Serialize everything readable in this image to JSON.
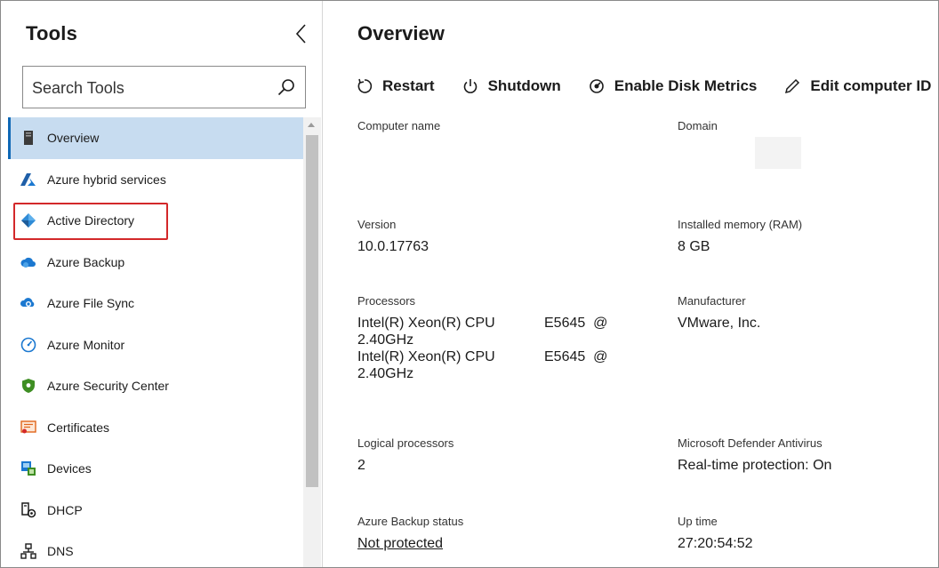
{
  "tools_pane": {
    "title": "Tools",
    "search": {
      "placeholder": "Search Tools",
      "value": ""
    },
    "items": [
      {
        "label": "Overview",
        "icon": "server-icon"
      },
      {
        "label": "Azure hybrid services",
        "icon": "azure-logo-icon"
      },
      {
        "label": "Active Directory",
        "icon": "active-directory-icon"
      },
      {
        "label": "Azure Backup",
        "icon": "cloud-backup-icon"
      },
      {
        "label": "Azure File Sync",
        "icon": "file-sync-icon"
      },
      {
        "label": "Azure Monitor",
        "icon": "gauge-icon"
      },
      {
        "label": "Azure Security Center",
        "icon": "shield-icon"
      },
      {
        "label": "Certificates",
        "icon": "certificate-icon"
      },
      {
        "label": "Devices",
        "icon": "devices-icon"
      },
      {
        "label": "DHCP",
        "icon": "dhcp-icon"
      },
      {
        "label": "DNS",
        "icon": "dns-icon"
      }
    ]
  },
  "overview": {
    "title": "Overview",
    "toolbar": {
      "restart": "Restart",
      "shutdown": "Shutdown",
      "enable_disk_metrics": "Enable Disk Metrics",
      "edit_computer_id": "Edit computer ID"
    },
    "computer_name": {
      "label": "Computer name",
      "value": ""
    },
    "domain": {
      "label": "Domain",
      "value": ""
    },
    "version": {
      "label": "Version",
      "value": "10.0.17763"
    },
    "memory": {
      "label": "Installed memory (RAM)",
      "value": "8 GB"
    },
    "processors": {
      "label": "Processors",
      "entries": [
        {
          "name": "Intel(R) Xeon(R) CPU",
          "model": "E5645  @",
          "speed": "2.40GHz"
        },
        {
          "name": "Intel(R) Xeon(R) CPU",
          "model": "E5645  @",
          "speed": "2.40GHz"
        }
      ]
    },
    "manufacturer": {
      "label": "Manufacturer",
      "value": "VMware, Inc."
    },
    "logical_processors": {
      "label": "Logical processors",
      "value": "2"
    },
    "defender": {
      "label": "Microsoft Defender Antivirus",
      "value": "Real-time protection: On"
    },
    "azure_backup": {
      "label": "Azure Backup status",
      "value": "Not protected"
    },
    "uptime": {
      "label": "Up time",
      "value": "27:20:54:52"
    }
  },
  "colors": {
    "selected_bg": "#c7dcf0",
    "accent": "#0e68b5",
    "highlight_border": "#d3282a",
    "link": "#0e5fb0"
  }
}
